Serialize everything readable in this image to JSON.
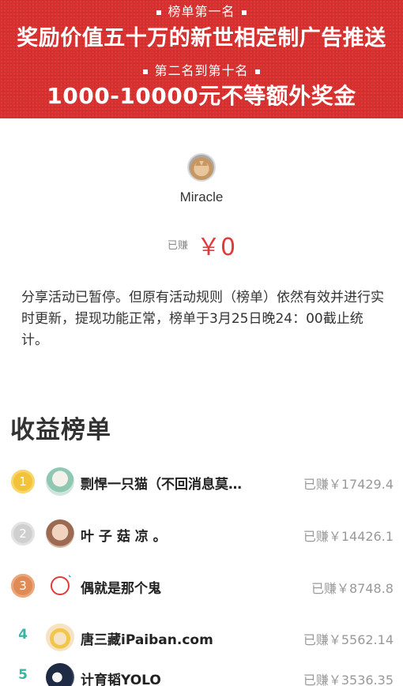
{
  "banner": {
    "line1": "榜单第一名",
    "line2": "奖励价值五十万的新世相定制广告推送",
    "line3": "第二名到第十名",
    "line4": "1000-10000元不等额外奖金"
  },
  "profile": {
    "name": "Miracle",
    "earned_label": "已赚",
    "earned_value": "￥0"
  },
  "notice": "分享活动已暂停。但原有活动规则（榜单）依然有效并进行实时更新，提现功能正常，榜单于3月25日晚24：00截止统计。",
  "leaderboard": {
    "title": "收益榜单",
    "rows": [
      {
        "rank": "1",
        "name": "剽悍一只猫（不回消息莫…",
        "earned": "已赚￥17429.4"
      },
      {
        "rank": "2",
        "name": "叶 子 菇 凉 。",
        "earned": "已赚￥14426.1"
      },
      {
        "rank": "3",
        "name": "偶就是那个鬼",
        "earned": "已赚￥8748.8"
      },
      {
        "rank": "4",
        "name": "唐三藏iPaiban.com",
        "earned": "已赚￥5562.14"
      },
      {
        "rank": "5",
        "name": "计育韬YOLO",
        "earned": "已赚￥3536.35"
      }
    ]
  },
  "colors": {
    "banner_red": "#d8302f",
    "accent_red": "#e03a3a",
    "rank_teal": "#3bb4a4"
  }
}
